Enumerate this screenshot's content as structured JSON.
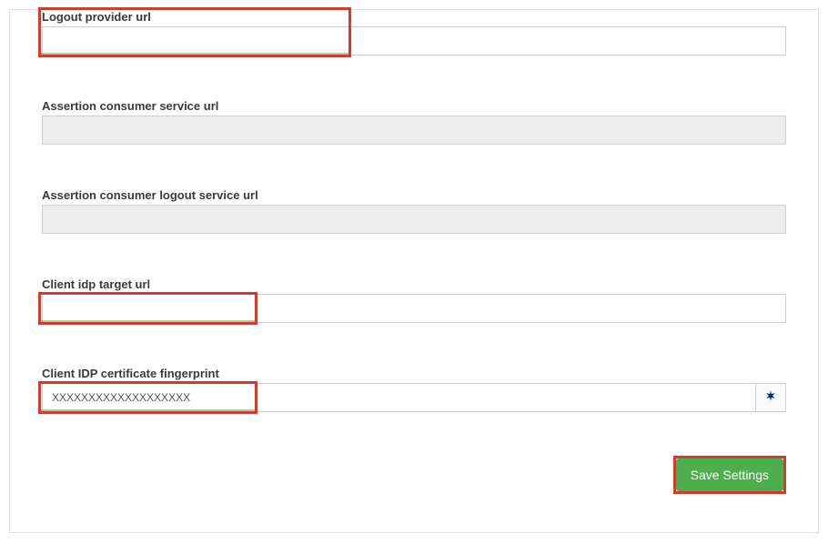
{
  "fields": {
    "logout_provider_url": {
      "label": "Logout provider url",
      "value": "",
      "placeholder": "",
      "readonly": false,
      "highlighted": true
    },
    "acs_url": {
      "label": "Assertion consumer service url",
      "value": "",
      "placeholder": "",
      "readonly": true,
      "highlighted": false
    },
    "acs_logout_url": {
      "label": "Assertion consumer logout service url",
      "value": "",
      "placeholder": "",
      "readonly": true,
      "highlighted": false
    },
    "client_idp_target_url": {
      "label": "Client idp target url",
      "value": "",
      "placeholder": "",
      "readonly": false,
      "highlighted": true
    },
    "client_idp_cert_fingerprint": {
      "label": "Client IDP certificate fingerprint",
      "value": "XXXXXXXXXXXXXXXXXXX",
      "placeholder": "",
      "readonly": false,
      "highlighted": true,
      "has_icon": true
    }
  },
  "buttons": {
    "save_label": "Save Settings"
  }
}
